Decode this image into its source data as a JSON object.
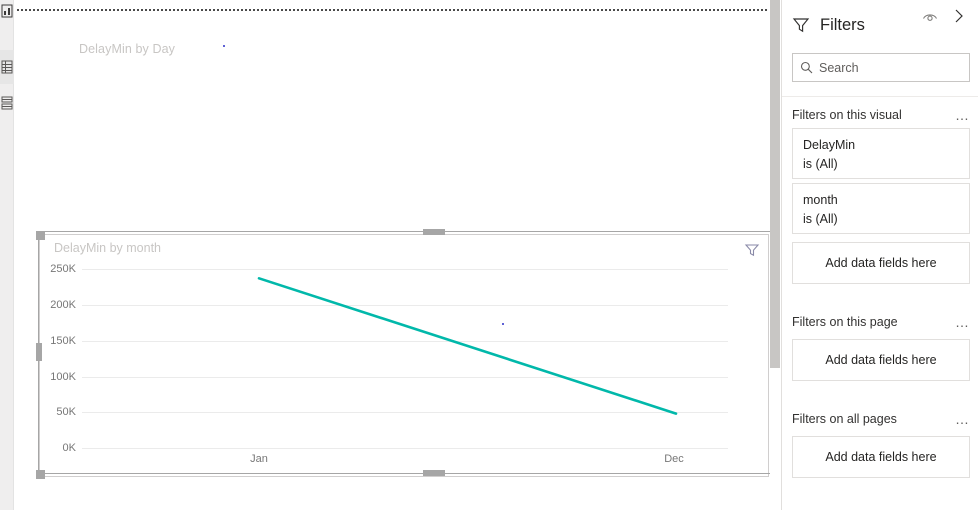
{
  "left_rail": {
    "items": [
      {
        "name": "report-view-icon",
        "active": false
      },
      {
        "name": "data-view-icon",
        "active": true
      },
      {
        "name": "model-view-icon",
        "active": false
      }
    ]
  },
  "canvas": {
    "visuals": [
      {
        "title": "DelayMin by Day",
        "selected": false
      },
      {
        "title": "DelayMin by month",
        "selected": true,
        "filter_icon": "funnel-icon"
      }
    ]
  },
  "chart_data": {
    "type": "line",
    "title": "DelayMin by month",
    "xlabel": "",
    "ylabel": "",
    "categories": [
      "Jan",
      "Dec"
    ],
    "x_tick_labels": [
      "Jan",
      "Dec"
    ],
    "y_tick_labels": [
      "250K",
      "200K",
      "150K",
      "100K",
      "50K",
      "0K"
    ],
    "y_tick_values": [
      250000,
      200000,
      150000,
      100000,
      50000,
      0
    ],
    "ylim": [
      0,
      250000
    ],
    "grid": true,
    "legend": "none",
    "series": [
      {
        "name": "DelayMin",
        "color": "#01B8AA",
        "values": [
          237000,
          48000
        ]
      }
    ]
  },
  "filters_pane": {
    "header": {
      "funnel_icon": "funnel-icon",
      "title": "Filters",
      "eye_icon": "eye-icon",
      "collapse_icon": "chevron-right-icon"
    },
    "search": {
      "icon": "search-icon",
      "placeholder": "Search"
    },
    "sections": [
      {
        "title": "Filters on this visual",
        "menu": "…",
        "cards": [
          {
            "field": "DelayMin",
            "value": "is (All)"
          },
          {
            "field": "month",
            "value": "is (All)"
          }
        ],
        "dropzone": "Add data fields here"
      },
      {
        "title": "Filters on this page",
        "menu": "…",
        "cards": [],
        "dropzone": "Add data fields here"
      },
      {
        "title": "Filters on all pages",
        "menu": "…",
        "cards": [],
        "dropzone": "Add data fields here"
      }
    ]
  }
}
